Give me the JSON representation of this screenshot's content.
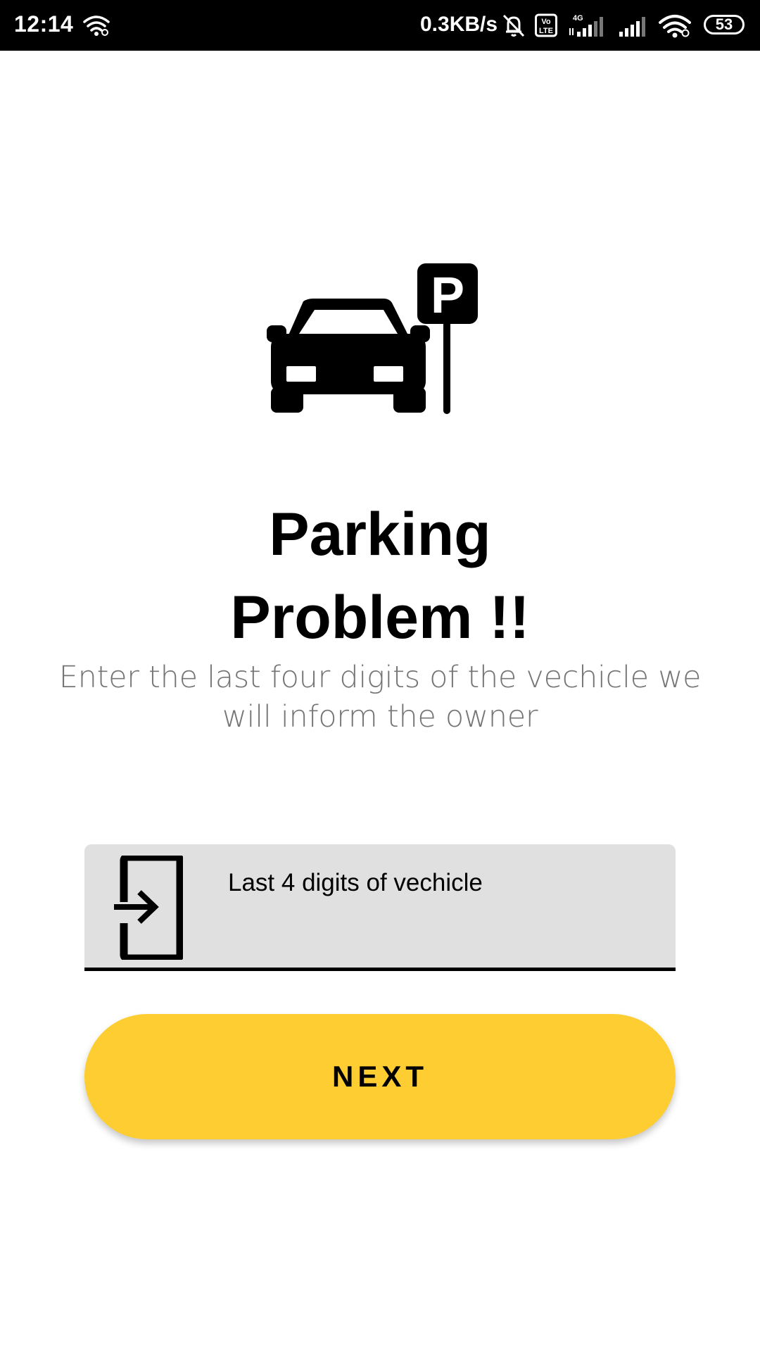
{
  "status_bar": {
    "time": "12:14",
    "network_speed": "0.3KB/s",
    "volte_label": "Vo LTE",
    "network_type": "4G",
    "battery": "53",
    "icons": [
      "wifi-icon",
      "mute-icon",
      "volte-icon",
      "signal-icon",
      "signal-icon",
      "wifi-icon",
      "battery-icon"
    ]
  },
  "hero": {
    "icon": "car-parking-icon",
    "parking_sign_letter": "P"
  },
  "title": {
    "line1": "Parking",
    "line2": "Problem !!"
  },
  "subtitle": "Enter the last four digits of the vechicle we will inform the owner",
  "form": {
    "vehicle_input": {
      "placeholder": "Last 4 digits of vechicle",
      "value": "",
      "icon": "phone-login-icon"
    },
    "next_button_label": "NEXT"
  },
  "colors": {
    "status_bar": "#000000",
    "background": "#ffffff",
    "accent": "#fdcd31",
    "input_background": "#e0e0e0",
    "subtitle_text": "#757575"
  }
}
